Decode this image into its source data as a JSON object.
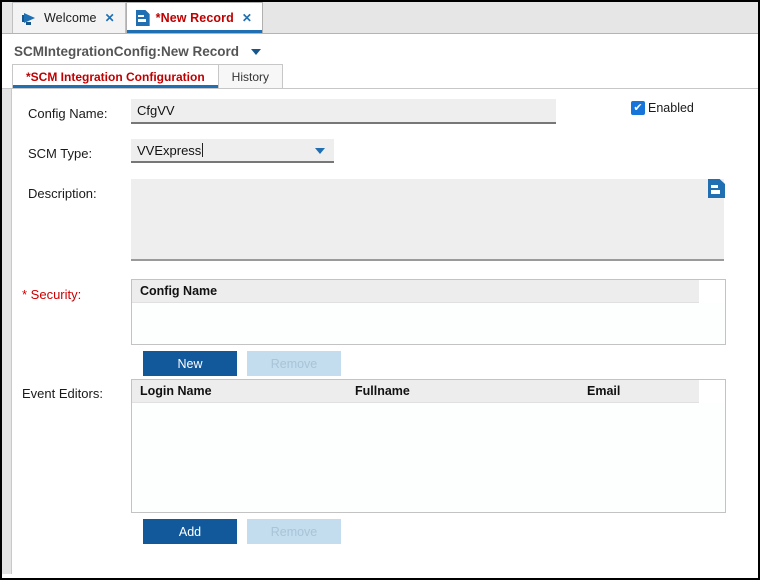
{
  "window_tabs": [
    {
      "label": "Welcome",
      "icon": "megaphone-icon",
      "close": "✕",
      "active": false
    },
    {
      "label": "*New Record",
      "icon": "document-icon",
      "close": "✕",
      "active": true
    }
  ],
  "record": {
    "title": "SCMIntegrationConfig:New Record",
    "menu_caret": "caret-down-icon"
  },
  "form_tabs": [
    {
      "label": "*SCM Integration Configuration",
      "active": true
    },
    {
      "label": "History",
      "active": false
    }
  ],
  "fields": {
    "config_name": {
      "label": "Config Name:",
      "value": "CfgVV",
      "placeholder": ""
    },
    "scm_type": {
      "label": "SCM Type:",
      "value": "VVExpress",
      "caret": "chevron-down-icon"
    },
    "description": {
      "label": "Description:",
      "value": "",
      "placeholder": "",
      "doc_icon": "document-icon"
    },
    "enabled": {
      "label": "Enabled",
      "checked": true,
      "check_glyph": "✔"
    }
  },
  "security": {
    "label": "* Security:",
    "required_marker": "*",
    "label_text": " Security:",
    "columns": [
      "Config Name"
    ],
    "rows": [],
    "buttons": [
      {
        "label": "New",
        "disabled": false
      },
      {
        "label": "Remove",
        "disabled": true
      }
    ]
  },
  "event_editors": {
    "label": "Event Editors:",
    "columns": [
      "Login Name",
      "Fullname",
      "Email"
    ],
    "rows": [],
    "buttons": [
      {
        "label": "Add",
        "disabled": false
      },
      {
        "label": "Remove",
        "disabled": true
      }
    ]
  },
  "colors": {
    "accent_blue": "#1f6fb2",
    "button_blue": "#12599c",
    "button_disabled": "#c3dcee",
    "required_red": "#cc0000",
    "active_tab_red": "#c00000",
    "field_grey": "#eeeeee",
    "header_grey": "#ededed"
  }
}
